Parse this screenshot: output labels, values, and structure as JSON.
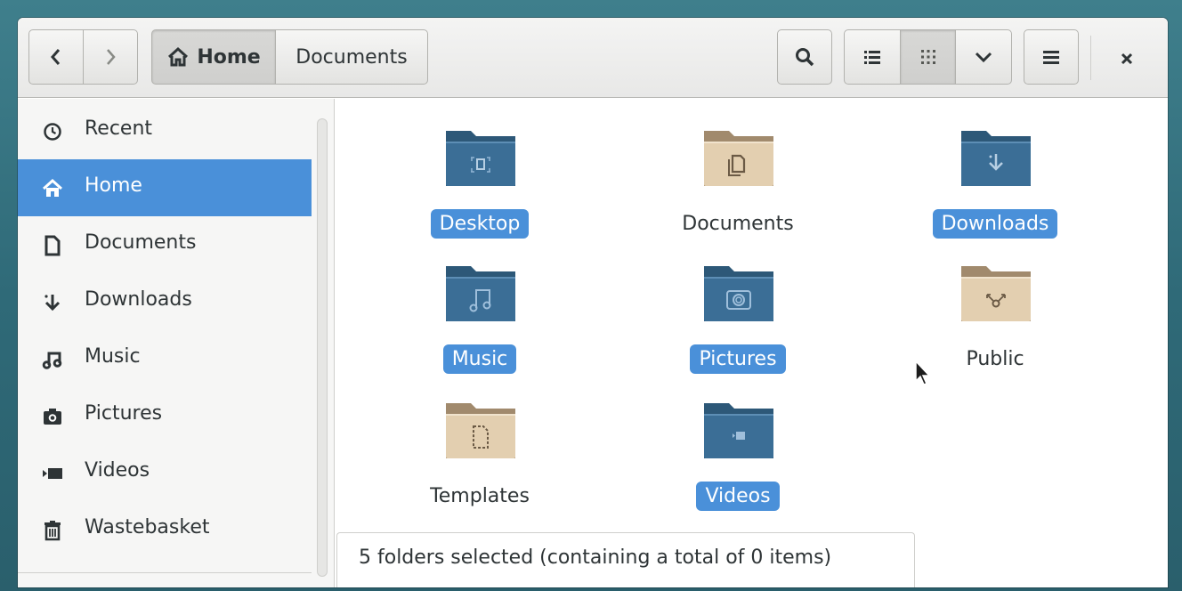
{
  "headerbar": {
    "back_icon": "chevron-left-icon",
    "forward_icon": "chevron-right-icon",
    "path": [
      {
        "label": "Home",
        "icon": "home-icon",
        "active": true
      },
      {
        "label": "Documents",
        "active": false
      }
    ],
    "search_icon": "search-icon",
    "view_list_icon": "list-view-icon",
    "view_grid_icon": "grid-view-icon",
    "view_options_icon": "chevron-down-icon",
    "menu_icon": "hamburger-icon",
    "close_icon": "close-icon"
  },
  "sidebar": {
    "items": [
      {
        "label": "Recent",
        "icon": "clock-icon",
        "selected": false
      },
      {
        "label": "Home",
        "icon": "home-icon",
        "selected": true
      },
      {
        "label": "Documents",
        "icon": "document-icon",
        "selected": false
      },
      {
        "label": "Downloads",
        "icon": "download-icon",
        "selected": false
      },
      {
        "label": "Music",
        "icon": "music-icon",
        "selected": false
      },
      {
        "label": "Pictures",
        "icon": "camera-icon",
        "selected": false
      },
      {
        "label": "Videos",
        "icon": "video-icon",
        "selected": false
      },
      {
        "label": "Wastebasket",
        "icon": "trash-icon",
        "selected": false
      }
    ]
  },
  "files": [
    {
      "name": "Desktop",
      "selected": true,
      "folder_color": "blue",
      "emblem": "desktop"
    },
    {
      "name": "Documents",
      "selected": false,
      "folder_color": "tan",
      "emblem": "documents"
    },
    {
      "name": "Downloads",
      "selected": true,
      "folder_color": "blue",
      "emblem": "download"
    },
    {
      "name": "Music",
      "selected": true,
      "folder_color": "blue",
      "emblem": "music"
    },
    {
      "name": "Pictures",
      "selected": true,
      "folder_color": "blue",
      "emblem": "camera"
    },
    {
      "name": "Public",
      "selected": false,
      "folder_color": "tan",
      "emblem": "share"
    },
    {
      "name": "Templates",
      "selected": false,
      "folder_color": "tan",
      "emblem": "template"
    },
    {
      "name": "Videos",
      "selected": true,
      "folder_color": "blue",
      "emblem": "video"
    }
  ],
  "status": {
    "text": "5 folders selected  (containing a total of 0 items)"
  },
  "colors": {
    "selection": "#4a90d9",
    "folder_blue": "#3b6e96",
    "folder_tan": "#e3cfb0"
  }
}
